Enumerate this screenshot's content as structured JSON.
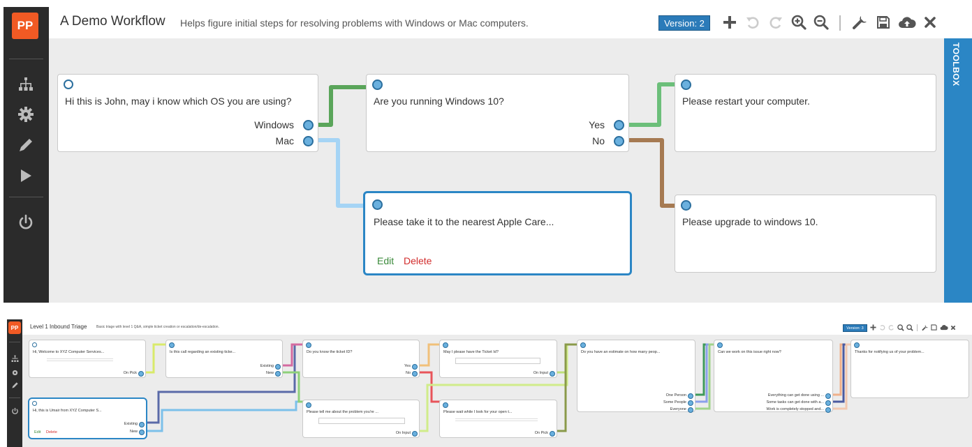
{
  "top": {
    "logo": "PP",
    "title": "A Demo Workflow",
    "subtitle": "Helps figure initial steps for resolving problems with Windows or Mac computers.",
    "version": "Version: 2",
    "toolbox": "TOOLBOX",
    "sidebar_icons": [
      "sitemap-icon",
      "gear-icon",
      "pencil-icon",
      "play-icon",
      "power-icon"
    ],
    "tools": [
      "plus-icon",
      "undo-icon",
      "redo-icon",
      "zoom-in-icon",
      "zoom-out-icon",
      "wrench-icon",
      "save-icon",
      "cloud-upload-icon",
      "close-icon"
    ],
    "nodes": {
      "n1": {
        "question": "Hi this is John, may i know which OS you are using?",
        "options": [
          "Windows",
          "Mac"
        ]
      },
      "n2": {
        "question": "Are you running Windows 10?",
        "options": [
          "Yes",
          "No"
        ]
      },
      "n3": {
        "question": "Please restart your computer."
      },
      "n4": {
        "question": "Please take it to the nearest Apple Care...",
        "edit": "Edit",
        "delete": "Delete"
      },
      "n5": {
        "question": "Please upgrade to windows 10."
      }
    },
    "wire_colors": {
      "windows": "#5aa55a",
      "mac": "#a5d4f5",
      "yes": "#6cbf7a",
      "no": "#a67a52"
    }
  },
  "bottom": {
    "logo": "PP",
    "title": "Level 1 Inbound Triage",
    "subtitle": "Basic triage with level 1 Q&A, simple ticket creation or escalation/de-escalation.",
    "version": "Version: 3",
    "nodes": {
      "b1": {
        "question": "Hi, Welcome to XYZ Computer Services...",
        "options": [
          "On Pick"
        ]
      },
      "b2": {
        "question": "Is this call regarding an existing ticke...",
        "options": [
          "Existing",
          "New"
        ]
      },
      "b3": {
        "question": "Do you know the ticket ID?",
        "options": [
          "Yes",
          "No"
        ]
      },
      "b4": {
        "question": "May I please have the Ticket Id?",
        "options": [
          "On Input"
        ]
      },
      "b5": {
        "question": "Do you have an estimate on how many peop...",
        "options": [
          "One Person",
          "Some People",
          "Everyone"
        ]
      },
      "b6": {
        "question": "Can we work on this issue right now?",
        "options": [
          "Everything can get done using ...",
          "Some tasks can get done with a...",
          "Work is completely stopped and..."
        ]
      },
      "b7": {
        "question": "Thanks for notifying us of your problem..."
      },
      "b8": {
        "question": "Hi, this is Umair from XYZ Computer S...",
        "options": [
          "Existing",
          "New"
        ],
        "edit": "Edit",
        "delete": "Delete"
      },
      "b9": {
        "question": "Please tell me about the problem you're ...",
        "options": [
          "On Input"
        ]
      },
      "b10": {
        "question": "Please wait while I look for your open t...",
        "options": [
          "On Pick"
        ]
      }
    }
  }
}
